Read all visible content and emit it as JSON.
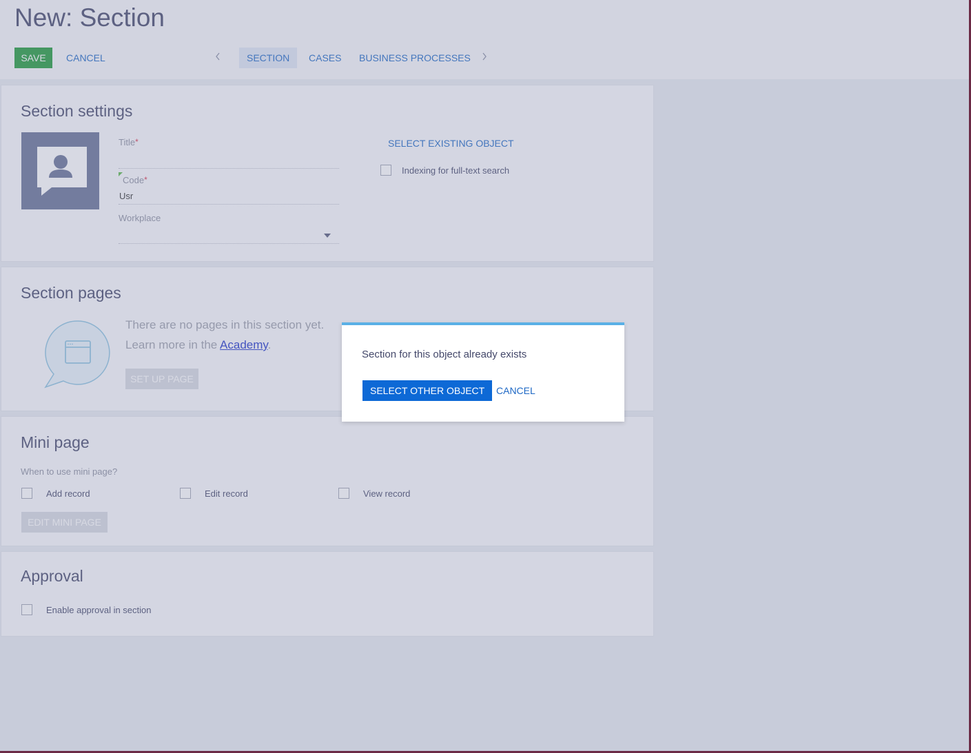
{
  "header": {
    "title": "New: Section",
    "save_label": "SAVE",
    "cancel_label": "CANCEL",
    "tabs": [
      {
        "label": "SECTION"
      },
      {
        "label": "CASES"
      },
      {
        "label": "BUSINESS PROCESSES"
      }
    ],
    "prev_icon": "chevron-left-icon",
    "next_icon": "chevron-right-icon"
  },
  "section_settings": {
    "title": "Section settings",
    "title_field": {
      "label": "Title",
      "required_mark": "*",
      "value": ""
    },
    "code_field": {
      "label": "Code",
      "required_mark": "*",
      "value": "Usr"
    },
    "workplace_field": {
      "label": "Workplace",
      "value": ""
    },
    "select_existing_label": "SELECT EXISTING OBJECT",
    "indexing_label": "Indexing for full-text search",
    "indexing_checked": false
  },
  "section_pages": {
    "title": "Section pages",
    "empty_line1": "There are no pages in this section yet.",
    "empty_line2_prefix": "Learn more in the ",
    "academy_link": "Academy",
    "empty_line2_suffix": ".",
    "setup_button": "SET UP PAGE"
  },
  "mini_page": {
    "title": "Mini page",
    "question": "When to use mini page?",
    "options": [
      {
        "label": "Add record",
        "checked": false
      },
      {
        "label": "Edit record",
        "checked": false
      },
      {
        "label": "View record",
        "checked": false
      }
    ],
    "edit_button": "EDIT MINI PAGE"
  },
  "approval": {
    "title": "Approval",
    "enable_label": "Enable approval in section",
    "checked": false
  },
  "dialog": {
    "message": "Section for this object already exists",
    "primary_label": "SELECT OTHER OBJECT",
    "cancel_label": "CANCEL"
  },
  "colors": {
    "save_green": "#1f9a3a",
    "link_blue": "#1e68c5",
    "primary_blue": "#0d69d6",
    "dialog_accent": "#5ab0e6"
  }
}
